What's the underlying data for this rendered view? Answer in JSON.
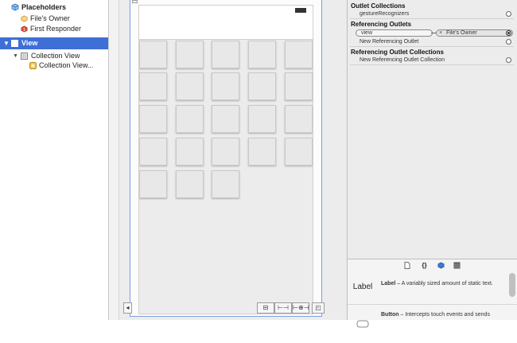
{
  "outline": {
    "placeholders": "Placeholders",
    "files_owner": "File's Owner",
    "first_responder": "First Responder",
    "view": "View",
    "collection_view": "Collection View",
    "collection_view_cell": "Collection View..."
  },
  "inspector": {
    "outlet_collections": "Outlet Collections",
    "gesture_recognizers": "gestureRecognizers",
    "referencing_outlets": "Referencing Outlets",
    "view_outlet": "view",
    "files_owner_target": "File's Owner",
    "target_remove_glyph": "×",
    "new_referencing_outlet": "New Referencing Outlet",
    "referencing_outlet_collections": "Referencing Outlet Collections",
    "new_referencing_outlet_collection": "New Referencing Outlet Collection"
  },
  "library": {
    "label_icon_text": "Label",
    "label_title": "Label",
    "label_desc": " – A variably sized amount of static text.",
    "button_title": "Button",
    "button_desc": " – Intercepts touch events and sends"
  },
  "colors": {
    "selection": "#3d6fd6",
    "accent_blue": "#3a7bd5"
  }
}
